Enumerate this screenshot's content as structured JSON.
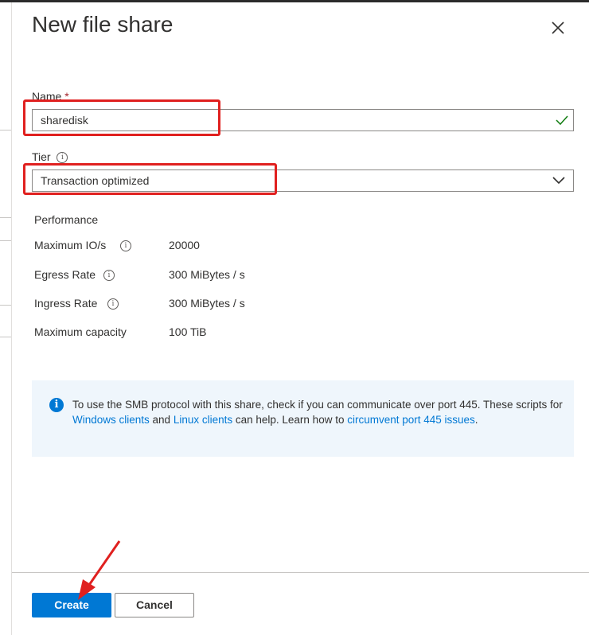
{
  "panel": {
    "title": "New file share",
    "close_label": "×"
  },
  "name_field": {
    "label": "Name",
    "required_mark": "*",
    "value": "sharedisk",
    "valid": true
  },
  "tier_field": {
    "label": "Tier",
    "info_glyph": "i",
    "selected": "Transaction optimized"
  },
  "performance": {
    "heading": "Performance",
    "rows": [
      {
        "label": "Maximum IO/s",
        "value": "20000",
        "has_info": true
      },
      {
        "label": "Egress Rate",
        "value": "300 MiBytes / s",
        "has_info": true
      },
      {
        "label": "Ingress Rate",
        "value": "300 MiBytes / s",
        "has_info": true
      },
      {
        "label": "Maximum capacity",
        "value": "100 TiB",
        "has_info": false
      }
    ]
  },
  "info_box": {
    "icon": "info-icon",
    "text_1": "To use the SMB protocol with this share, check if you can communicate over port 445. These scripts for ",
    "link_windows": "Windows clients",
    "text_2": " and ",
    "link_linux": "Linux clients",
    "text_3": " can help. Learn how to ",
    "link_circumvent": "circumvent port 445 issues",
    "text_4": "."
  },
  "footer": {
    "create_label": "Create",
    "cancel_label": "Cancel"
  },
  "colors": {
    "accent": "#0078d4",
    "annotation": "#e0201f",
    "info_bg": "#eff6fc",
    "valid_check": "#107c10"
  }
}
